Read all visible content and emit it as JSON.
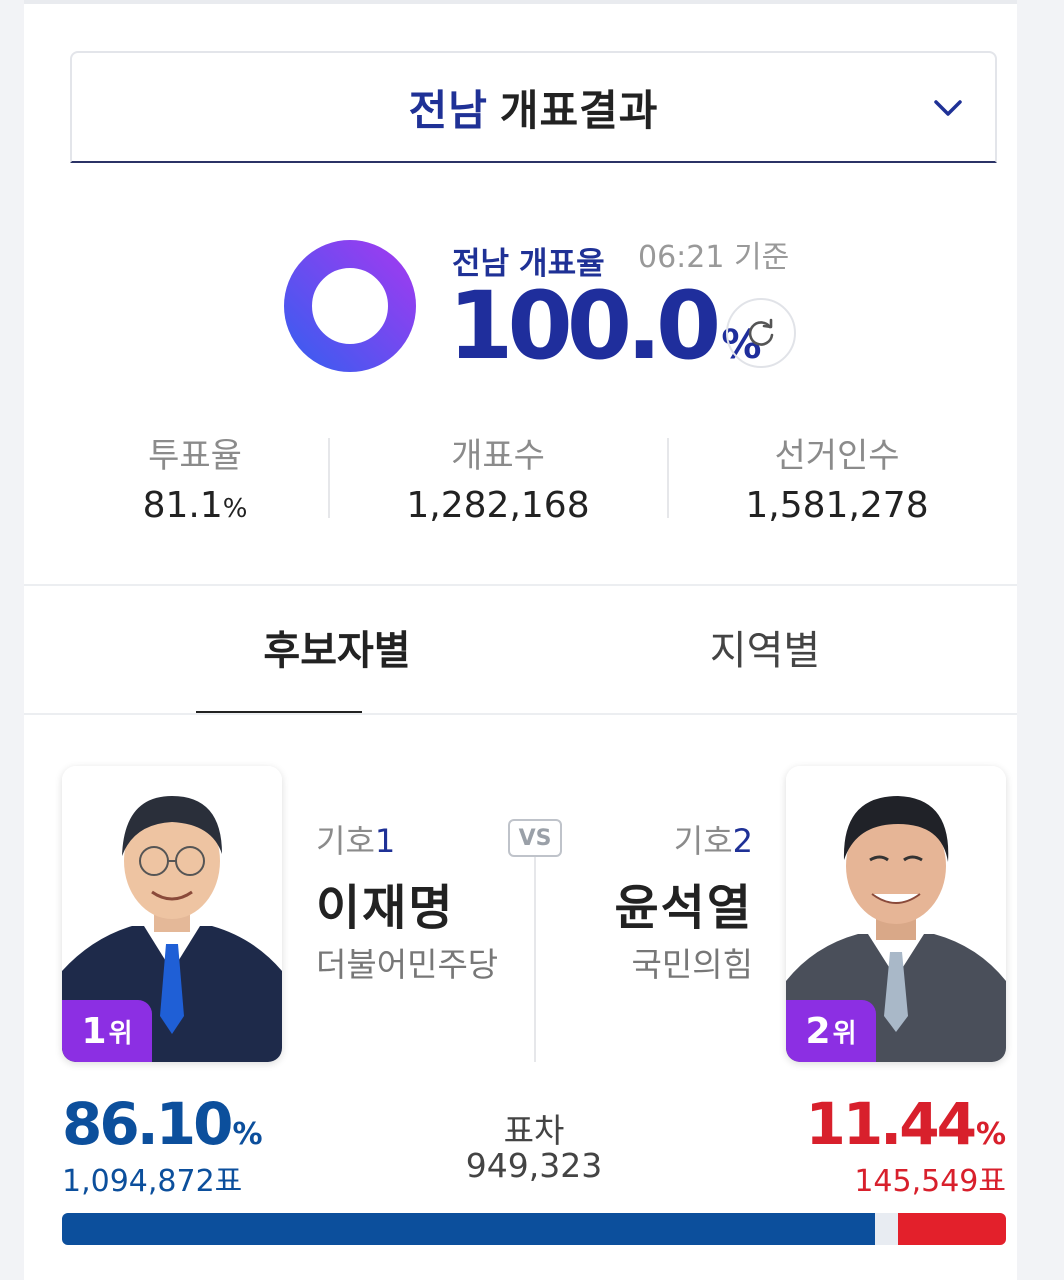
{
  "header": {
    "region": "전남",
    "title_rest": "개표결과"
  },
  "progress": {
    "region": "전남",
    "label": "개표율",
    "time": "06:21 기준",
    "value": "100.0",
    "unit": "%",
    "fraction": 1.0
  },
  "stats": [
    {
      "label": "투표율",
      "value": "81.1",
      "unit": "%"
    },
    {
      "label": "개표수",
      "value": "1,282,168"
    },
    {
      "label": "선거인수",
      "value": "1,581,278"
    }
  ],
  "tabs": [
    {
      "label": "후보자별",
      "active": true
    },
    {
      "label": "지역별",
      "active": false
    }
  ],
  "vs_label": "VS",
  "candidates": [
    {
      "number_prefix": "기호",
      "number": "1",
      "name": "이재명",
      "party": "더불어민주당",
      "rank_num": "1",
      "rank_unit": "위",
      "percent": "86.10",
      "percent_unit": "%",
      "votes": "1,094,872표",
      "share": 86.1,
      "color": "#0c4f9c",
      "tie_color": "#1f5fd6"
    },
    {
      "number_prefix": "기호",
      "number": "2",
      "name": "윤석열",
      "party": "국민의힘",
      "rank_num": "2",
      "rank_unit": "위",
      "percent": "11.44",
      "percent_unit": "%",
      "votes": "145,549표",
      "share": 11.44,
      "color": "#d8202c",
      "tie_color": "#8fa3b8"
    }
  ],
  "difference": {
    "label": "표차",
    "value": "949,323"
  },
  "colors": {
    "accent": "#1f3196",
    "rank_badge": "#8c2fe3",
    "donut_start": "#3f5bf0",
    "donut_end": "#9b3cf0"
  }
}
